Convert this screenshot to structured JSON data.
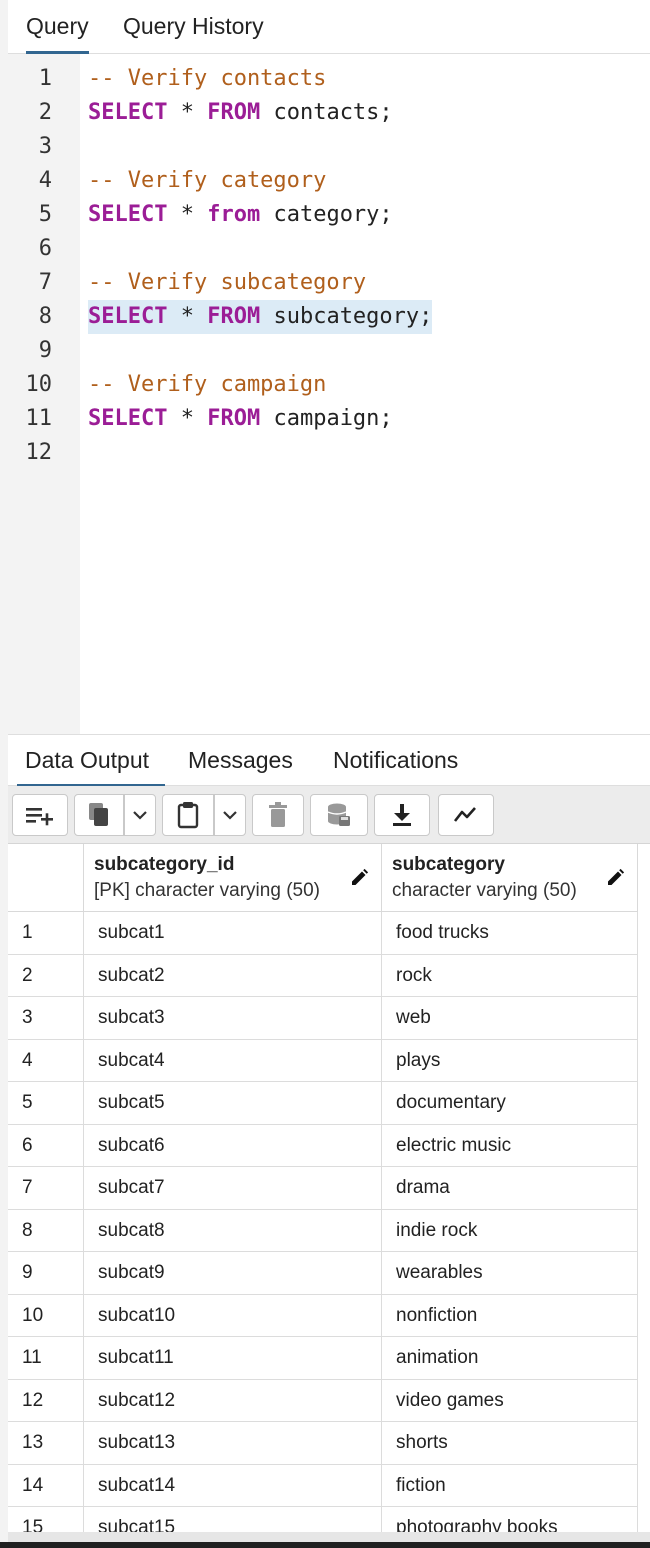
{
  "query_tabs": [
    {
      "label": "Query",
      "active": true
    },
    {
      "label": "Query History",
      "active": false
    }
  ],
  "editor": {
    "lines": [
      {
        "n": "1",
        "tokens": [
          {
            "t": "-- Verify contacts",
            "c": "cm"
          }
        ]
      },
      {
        "n": "2",
        "tokens": [
          {
            "t": "SELECT",
            "c": "kw"
          },
          {
            "t": " * ",
            "c": "tx"
          },
          {
            "t": "FROM",
            "c": "kw"
          },
          {
            "t": " contacts;",
            "c": "tx"
          }
        ]
      },
      {
        "n": "3",
        "tokens": []
      },
      {
        "n": "4",
        "tokens": [
          {
            "t": "-- Verify category",
            "c": "cm"
          }
        ]
      },
      {
        "n": "5",
        "tokens": [
          {
            "t": "SELECT",
            "c": "kw"
          },
          {
            "t": " * ",
            "c": "tx"
          },
          {
            "t": "from",
            "c": "kw"
          },
          {
            "t": " category;",
            "c": "tx"
          }
        ]
      },
      {
        "n": "6",
        "tokens": []
      },
      {
        "n": "7",
        "tokens": [
          {
            "t": "-- Verify subcategory",
            "c": "cm"
          }
        ]
      },
      {
        "n": "8",
        "highlight": true,
        "tokens": [
          {
            "t": "SELECT",
            "c": "kw"
          },
          {
            "t": " * ",
            "c": "tx"
          },
          {
            "t": "FROM",
            "c": "kw"
          },
          {
            "t": " subcategory;",
            "c": "tx"
          }
        ]
      },
      {
        "n": "9",
        "tokens": []
      },
      {
        "n": "10",
        "tokens": [
          {
            "t": "-- Verify campaign",
            "c": "cm"
          }
        ]
      },
      {
        "n": "11",
        "tokens": [
          {
            "t": "SELECT",
            "c": "kw"
          },
          {
            "t": " * ",
            "c": "tx"
          },
          {
            "t": "FROM",
            "c": "kw"
          },
          {
            "t": " campaign;",
            "c": "tx"
          }
        ]
      },
      {
        "n": "12",
        "tokens": []
      }
    ]
  },
  "output_tabs": [
    {
      "label": "Data Output",
      "active": true
    },
    {
      "label": "Messages",
      "active": false
    },
    {
      "label": "Notifications",
      "active": false
    }
  ],
  "toolbar": {
    "buttons": [
      "add-row-icon",
      "copy-icon",
      "chevron-down-icon",
      "paste-icon",
      "chevron-down-icon",
      "delete-icon",
      "save-data-icon",
      "download-icon",
      "graph-icon"
    ]
  },
  "grid": {
    "columns": [
      {
        "name": "subcategory_id",
        "type": "[PK] character varying (50)"
      },
      {
        "name": "subcategory",
        "type": "character varying (50)"
      }
    ],
    "rows": [
      [
        "1",
        "subcat1",
        "food trucks"
      ],
      [
        "2",
        "subcat2",
        "rock"
      ],
      [
        "3",
        "subcat3",
        "web"
      ],
      [
        "4",
        "subcat4",
        "plays"
      ],
      [
        "5",
        "subcat5",
        "documentary"
      ],
      [
        "6",
        "subcat6",
        "electric music"
      ],
      [
        "7",
        "subcat7",
        "drama"
      ],
      [
        "8",
        "subcat8",
        "indie rock"
      ],
      [
        "9",
        "subcat9",
        "wearables"
      ],
      [
        "10",
        "subcat10",
        "nonfiction"
      ],
      [
        "11",
        "subcat11",
        "animation"
      ],
      [
        "12",
        "subcat12",
        "video games"
      ],
      [
        "13",
        "subcat13",
        "shorts"
      ],
      [
        "14",
        "subcat14",
        "fiction"
      ],
      [
        "15",
        "subcat15",
        "photography books"
      ]
    ]
  },
  "colors": {
    "accent": "#326690",
    "keyword": "#9b1d96",
    "comment": "#b05f1c",
    "highlight": "#dcebf6"
  }
}
